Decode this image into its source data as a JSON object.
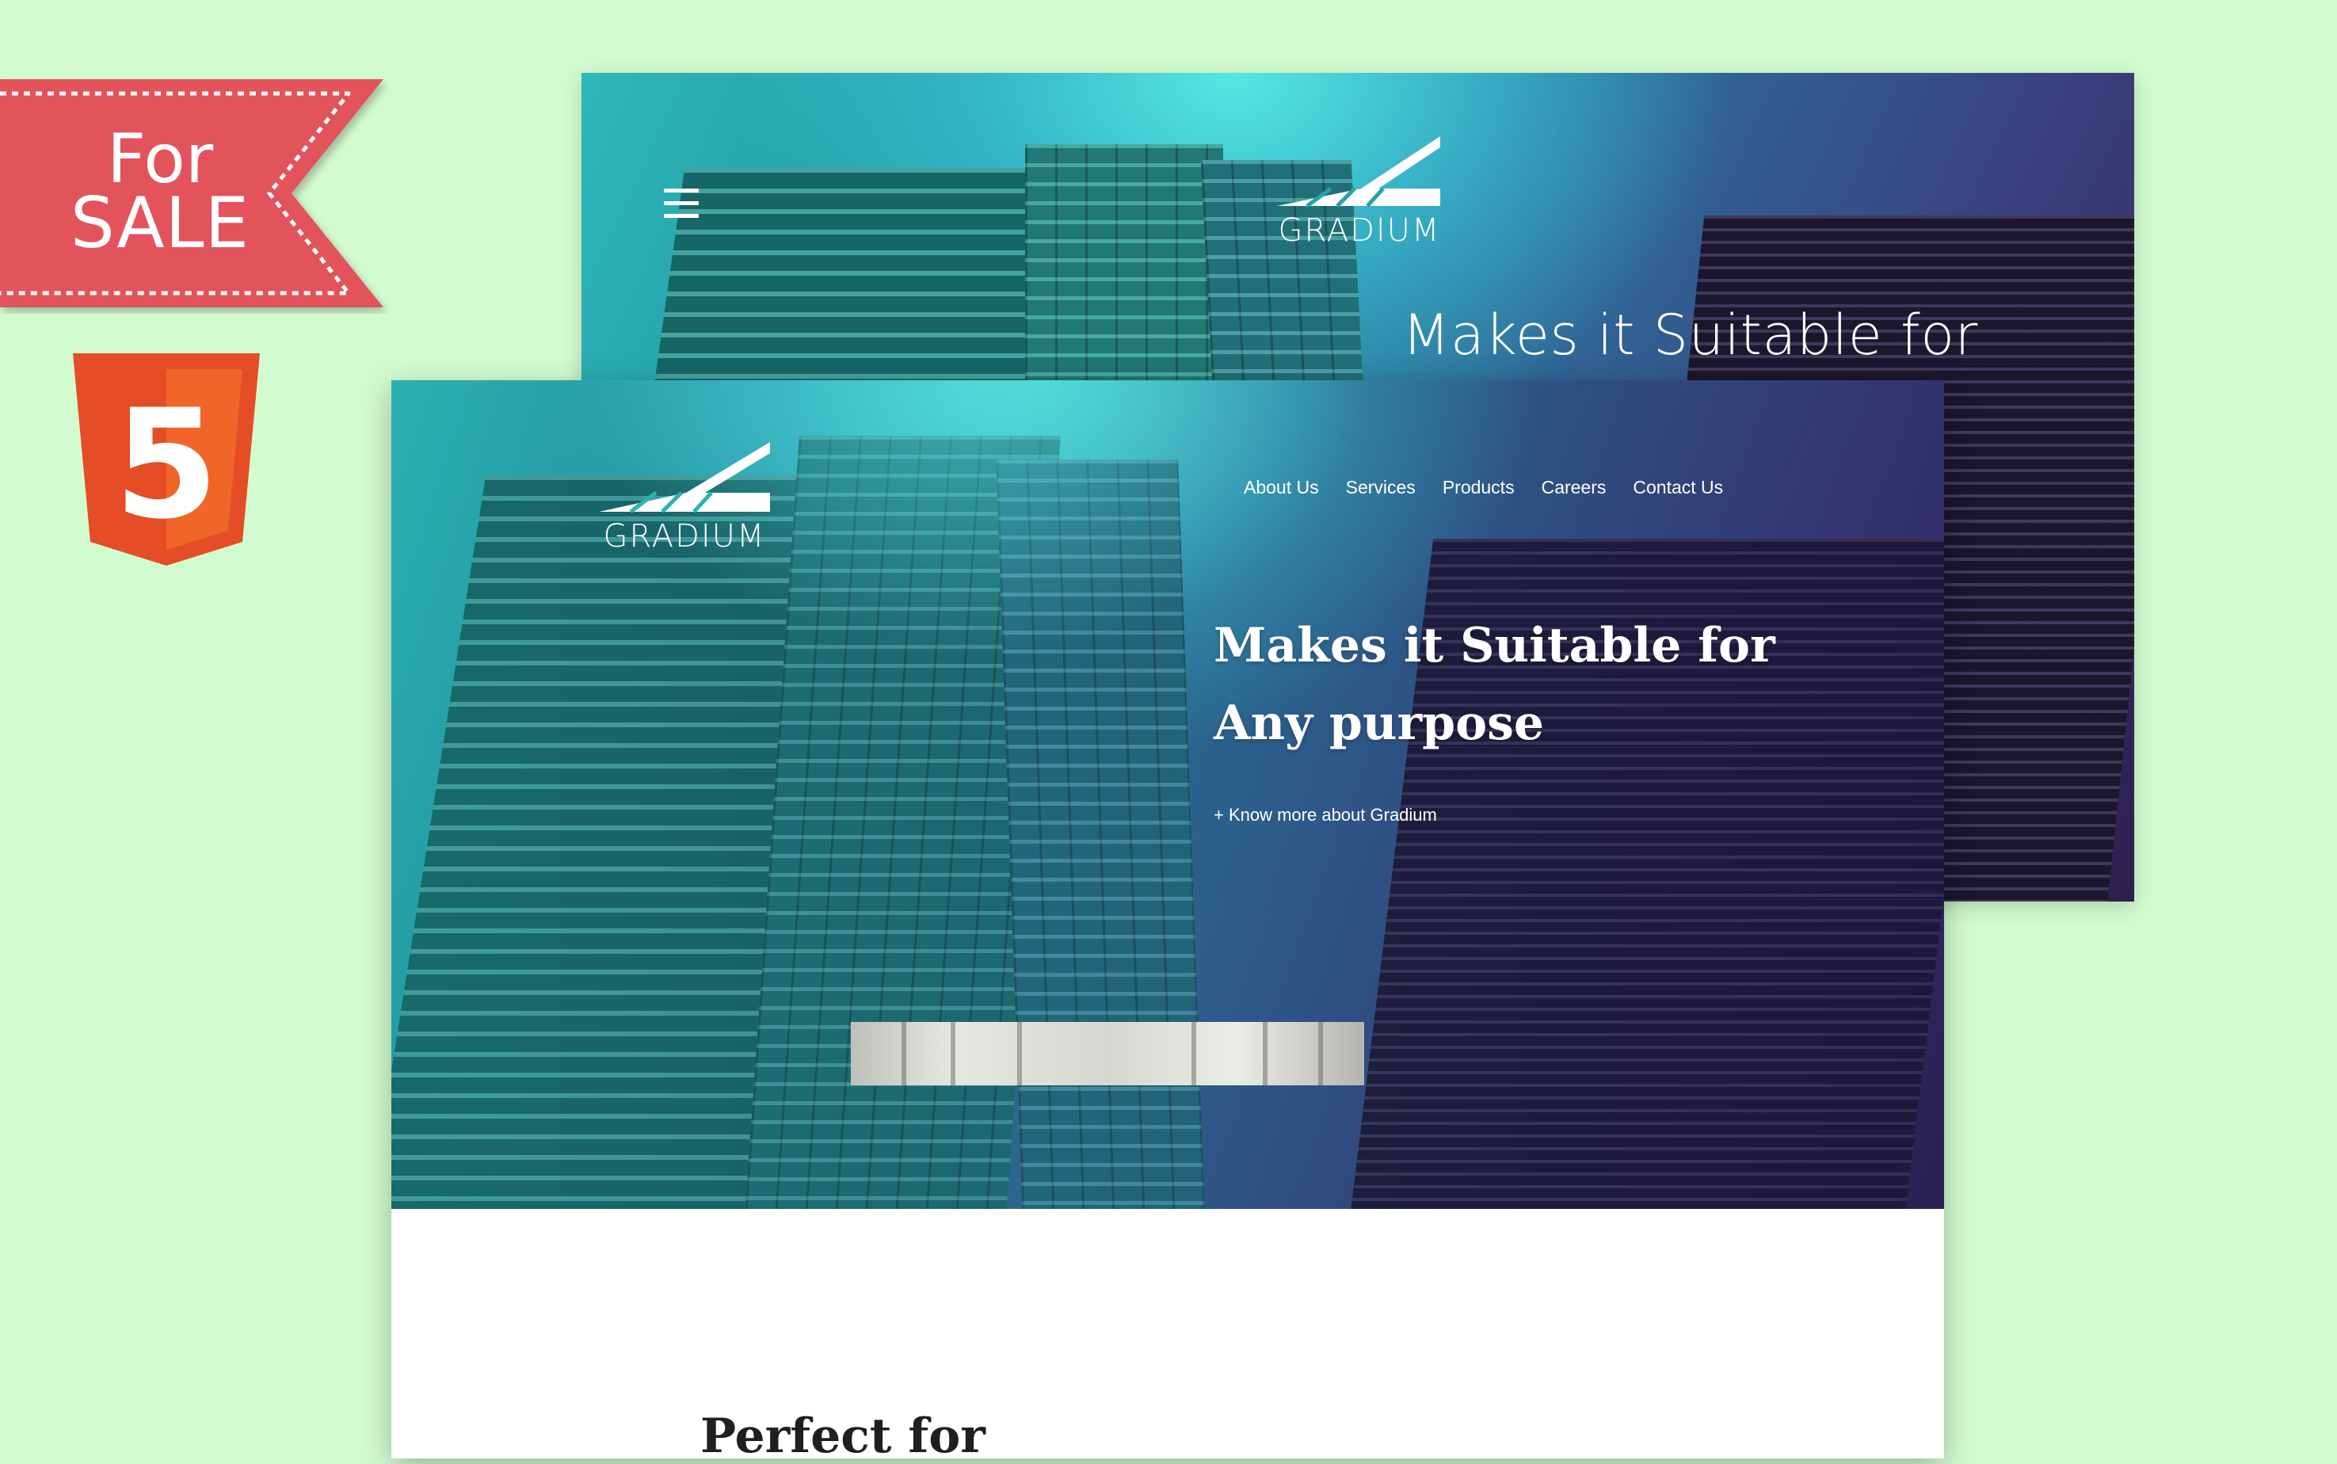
{
  "badge": {
    "line1": "For",
    "line2": "SALE",
    "color": "#e2535c"
  },
  "tech_logo": {
    "icon": "html5-icon",
    "numeral": "5",
    "colors": {
      "outer": "#e44d26",
      "inner": "#f16529"
    }
  },
  "back_mock": {
    "menu_icon": "hamburger-icon",
    "brand": "GRADIUM",
    "hero_heading": "Makes it Suitable for"
  },
  "front_mock": {
    "brand": "GRADIUM",
    "nav": [
      "About Us",
      "Services",
      "Products",
      "Careers",
      "Contact Us"
    ],
    "hero": {
      "title_line1": "Makes it Suitable for",
      "title_line2": "Any purpose",
      "link": "+ Know more about Gradium"
    },
    "section": {
      "heading": "Perfect for"
    }
  },
  "colors": {
    "page_bg": "#d3fbd0",
    "hero_teal": "#3fd6d8",
    "hero_purple": "#3a2a6b"
  }
}
